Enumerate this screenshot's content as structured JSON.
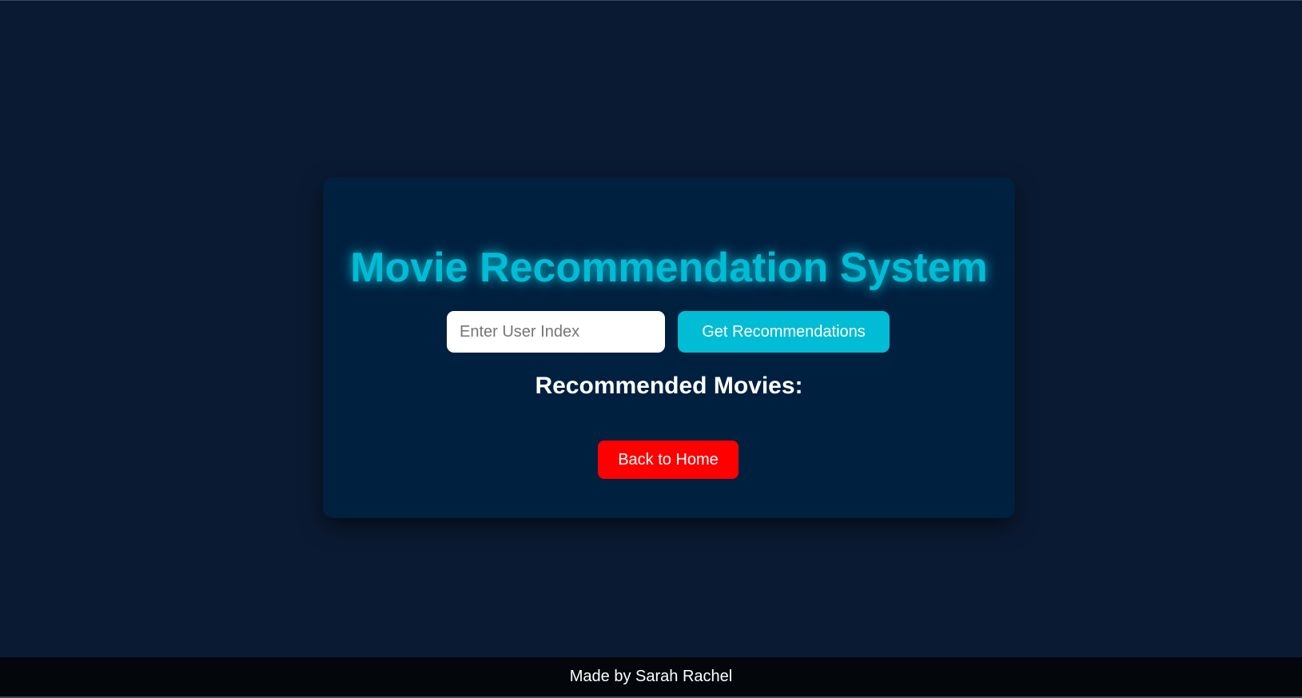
{
  "header": {
    "title": "Movie Recommendation System"
  },
  "form": {
    "user_index_placeholder": "Enter User Index",
    "user_index_value": "",
    "submit_label": "Get Recommendations"
  },
  "results": {
    "heading": "Recommended Movies:",
    "items": []
  },
  "navigation": {
    "back_label": "Back to Home"
  },
  "footer": {
    "credit": "Made by Sarah Rachel"
  },
  "colors": {
    "page_background": "#0b1a33",
    "card_background": "#00203f",
    "accent": "#00bcd4",
    "back_button": "#ff0000",
    "footer_background": "#03070c"
  }
}
